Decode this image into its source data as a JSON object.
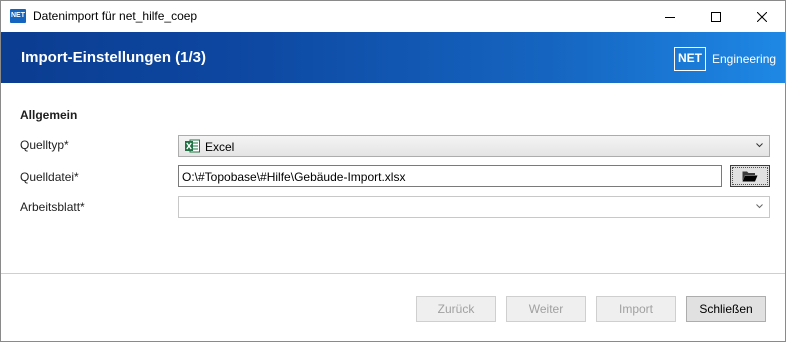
{
  "window": {
    "title": "Datenimport für net_hilfe_coep",
    "app_icon_text": "NET"
  },
  "header": {
    "title": "Import-Einstellungen (1/3)",
    "logo_box": "NET",
    "logo_text": "Engineering"
  },
  "section": {
    "title": "Allgemein"
  },
  "fields": {
    "quelltyp": {
      "label": "Quelltyp*",
      "value": "Excel",
      "icon": "excel-icon"
    },
    "quelldatei": {
      "label": "Quelldatei*",
      "value": "O:\\#Topobase\\#Hilfe\\Gebäude-Import.xlsx",
      "button_icon": "folder-open-icon"
    },
    "arbeitsblatt": {
      "label": "Arbeitsblatt*",
      "value": ""
    }
  },
  "buttons": {
    "back": "Zurück",
    "next": "Weiter",
    "import": "Import",
    "close": "Schließen"
  },
  "colors": {
    "header_start": "#0b3d91",
    "header_end": "#1e88e5",
    "excel_green": "#217346"
  }
}
